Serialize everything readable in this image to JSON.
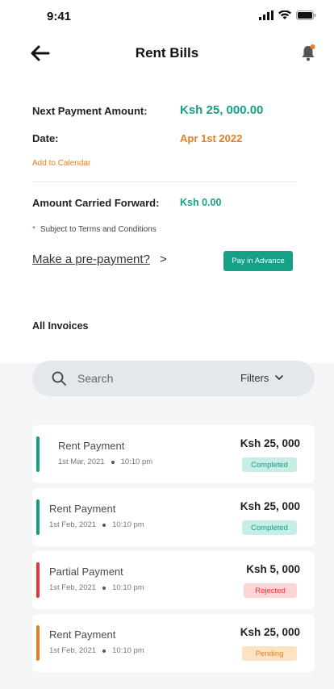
{
  "status_bar": {
    "time": "9:41"
  },
  "header": {
    "title": "Rent Bills"
  },
  "summary": {
    "next_payment_label": "Next Payment Amount:",
    "next_payment_value": "Ksh 25, 000.00",
    "date_label": "Date:",
    "date_value": "Apr 1st 2022",
    "add_to_calendar": "Add to Calendar",
    "carried_label": "Amount Carried Forward:",
    "carried_value": "Ksh 0.00",
    "terms": "Subject to Terms and Conditions",
    "prepayment_link": "Make a pre-payment?",
    "prepayment_arrow": ">",
    "pay_in_advance": "Pay in Advance"
  },
  "invoices": {
    "heading": "All Invoices",
    "search_placeholder": "Search",
    "filters_label": "Filters",
    "items": [
      {
        "title": "Rent Payment",
        "date": "1st Mar, 2021",
        "time": "10:10 pm",
        "amount": "Ksh 25, 000",
        "status": "Completed"
      },
      {
        "title": "Rent Payment",
        "date": "1st Feb, 2021",
        "time": "10:10 pm",
        "amount": "Ksh 25, 000",
        "status": "Completed"
      },
      {
        "title": "Partial Payment",
        "date": "1st Feb, 2021",
        "time": "10:10 pm",
        "amount": "Ksh 5, 000",
        "status": "Rejected"
      },
      {
        "title": "Rent Payment",
        "date": "1st Feb, 2021",
        "time": "10:10 pm",
        "amount": "Ksh 25, 000",
        "status": "Pending"
      }
    ]
  },
  "colors": {
    "teal": "#16a085",
    "orange": "#e67e22",
    "red": "#e53935",
    "completed_bg": "#c8ede4",
    "rejected_bg": "#fcd4d6",
    "pending_bg": "#fde3c2"
  },
  "icons": {
    "back": "arrow-left-icon",
    "bell": "bell-icon",
    "search": "search-icon",
    "filters": "chevron-down-icon",
    "signal": "signal-icon",
    "wifi": "wifi-icon",
    "battery": "battery-icon"
  }
}
